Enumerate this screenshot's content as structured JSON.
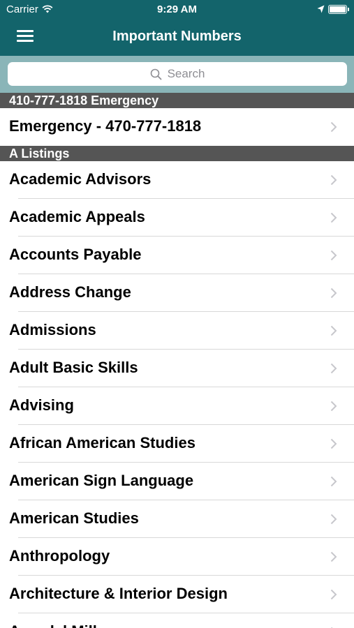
{
  "status_bar": {
    "carrier": "Carrier",
    "time": "9:29 AM",
    "icons": [
      "wifi-icon",
      "location-arrow-icon",
      "battery-icon"
    ]
  },
  "nav": {
    "title": "Important Numbers",
    "menu_icon": "hamburger-menu-icon"
  },
  "search": {
    "placeholder": "Search",
    "icon": "search-icon"
  },
  "colors": {
    "nav_background": "#13646b",
    "search_background": "#8ab5b8",
    "section_header_background": "#555555",
    "chevron": "#c7c7cc"
  },
  "sections": [
    {
      "header": "410-777-1818 Emergency",
      "items": [
        {
          "label": "Emergency - 470-777-1818"
        }
      ]
    },
    {
      "header": "A Listings",
      "items": [
        {
          "label": "Academic Advisors"
        },
        {
          "label": "Academic Appeals"
        },
        {
          "label": "Accounts Payable"
        },
        {
          "label": "Address Change"
        },
        {
          "label": "Admissions"
        },
        {
          "label": "Adult Basic Skills"
        },
        {
          "label": "Advising"
        },
        {
          "label": "African American Studies"
        },
        {
          "label": "American Sign Language"
        },
        {
          "label": "American Studies"
        },
        {
          "label": "Anthropology"
        },
        {
          "label": "Architecture & Interior Design"
        },
        {
          "label": "Arundel Mills"
        }
      ]
    }
  ]
}
